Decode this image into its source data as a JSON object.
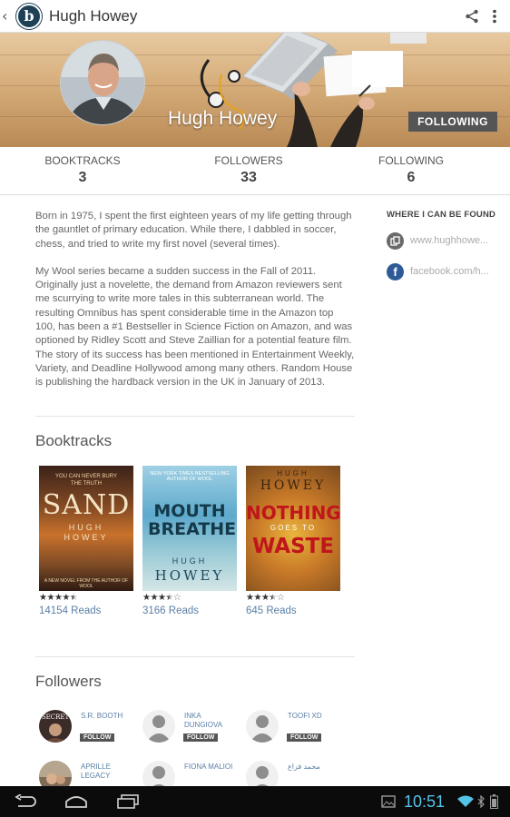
{
  "app_bar": {
    "back_glyph": "‹",
    "logo_letter": "b",
    "title": "Hugh Howey",
    "actions": [
      "share-icon",
      "more-vert-icon"
    ]
  },
  "hero": {
    "name": "Hugh Howey",
    "follow_button": "FOLLOWING"
  },
  "stats": [
    {
      "label": "BOOKTRACKS",
      "value": "3"
    },
    {
      "label": "FOLLOWERS",
      "value": "33"
    },
    {
      "label": "FOLLOWING",
      "value": "6"
    }
  ],
  "bio": {
    "p1": "Born in 1975, I spent the first eighteen years of my life getting through the gauntlet of primary education. While there, I dabbled in soccer, chess, and tried to write my first novel (several times).",
    "p2": "My Wool series became a sudden success in the Fall of 2011. Originally just a novelette, the demand from Amazon reviewers sent me scurrying to write more tales in this subterranean world. The resulting Omnibus has spent considerable time in the Amazon top 100, has been a #1 Bestseller in Science Fiction on Amazon, and was optioned by Ridley Scott and Steve Zaillian for a potential feature film. The story of its success has been mentioned in Entertainment Weekly, Variety, and Deadline Hollywood among many others. Random House is publishing the hardback version in the UK in January of 2013."
  },
  "sidebar": {
    "heading": "WHERE I CAN BE FOUND",
    "links": [
      {
        "icon": "web-icon",
        "text": "www.hughhowe..."
      },
      {
        "icon": "facebook-icon",
        "text": "facebook.com/h..."
      }
    ]
  },
  "booktracks": {
    "heading": "Booktracks",
    "books": [
      {
        "tagline": "YOU CAN NEVER BURY THE TRUTH",
        "title": "SAND",
        "author_line1": "HUGH",
        "author_line2": "HOWEY",
        "footer": "A NEW NOVEL FROM THE AUTHOR OF WOOL",
        "rating": 4.5,
        "reads": "14154 Reads"
      },
      {
        "tagline": "NEW YORK TIMES BESTSELLING AUTHOR OF WOOL",
        "title": "MOUTH BREATHERS",
        "author_line1": "HUGH",
        "author_line2": "HOWEY",
        "footer": "",
        "rating": 3.5,
        "reads": "3166 Reads"
      },
      {
        "tagline": "",
        "title": "NOTHING",
        "subtitle": "GOES TO",
        "title2": "WASTE",
        "author_line1": "HUGH",
        "author_line2": "HOWEY",
        "footer": "",
        "rating": 3.5,
        "reads": "645 Reads"
      }
    ]
  },
  "followers": {
    "heading": "Followers",
    "follow_label": "FOLLOW",
    "people": [
      {
        "name": "S.R. BOOTH",
        "avatar": "photo",
        "avatar_text": "SECRET"
      },
      {
        "name": "INKA DUNGIOVA",
        "avatar": "default"
      },
      {
        "name": "TOOFI XD",
        "avatar": "default"
      },
      {
        "name": "APRILLE LEGACY",
        "avatar": "photo",
        "avatar_text": ""
      },
      {
        "name": "FIONA MALIOI",
        "avatar": "default"
      },
      {
        "name": "محمد فزاع",
        "avatar": "default"
      }
    ]
  },
  "system_bar": {
    "time": "10:51",
    "nav": [
      "back-nav-icon",
      "home-nav-icon",
      "recents-nav-icon"
    ],
    "status": [
      "gallery-icon",
      "wifi-icon",
      "bluetooth-icon",
      "battery-icon"
    ]
  },
  "colors": {
    "accent_blue": "#5a7fa6",
    "logo_bg": "#1f4156",
    "follow_button_bg": "#555555",
    "clock": "#54c3e8"
  }
}
